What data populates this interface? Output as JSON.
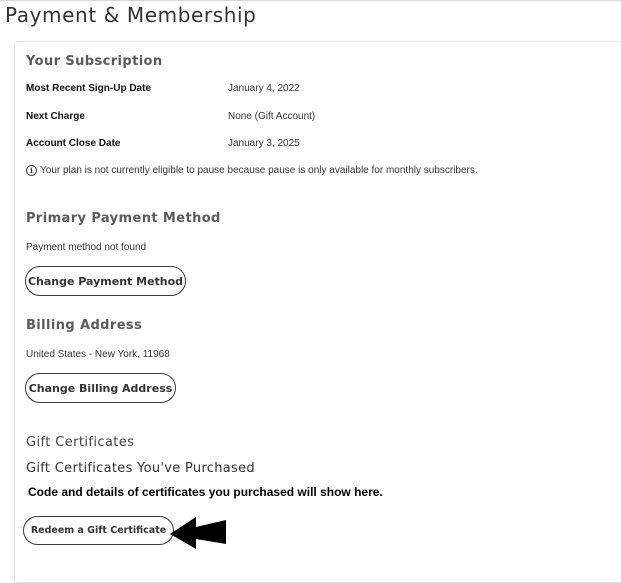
{
  "page": {
    "title": "Payment & Membership"
  },
  "subscription": {
    "heading": "Your Subscription",
    "rows": [
      {
        "label": "Most Recent Sign-Up Date",
        "value": "January 4, 2022"
      },
      {
        "label": "Next Charge",
        "value": "None (Gift Account)"
      },
      {
        "label": "Account Close Date",
        "value": "January 3, 2025"
      }
    ],
    "pause_note": "Your plan is not currently eligible to pause because pause is only available for monthly subscribers."
  },
  "payment": {
    "heading": "Primary Payment Method",
    "status": "Payment method not found",
    "button": "Change Payment Method"
  },
  "billing": {
    "heading": "Billing Address",
    "address": "United States - New York, 11968",
    "button": "Change Billing Address"
  },
  "gift": {
    "heading": "Gift Certificates",
    "subheading": "Gift Certificates You've Purchased",
    "note": "Code and details of certificates you purchased will show here.",
    "button": "Redeem a Gift Certificate"
  },
  "icons": {
    "info": "info-circle-icon",
    "arrow": "left-arrow-annotation-icon"
  },
  "colors": {
    "text": "#222222",
    "border": "#3a3a3a",
    "arrow": "#000000"
  }
}
